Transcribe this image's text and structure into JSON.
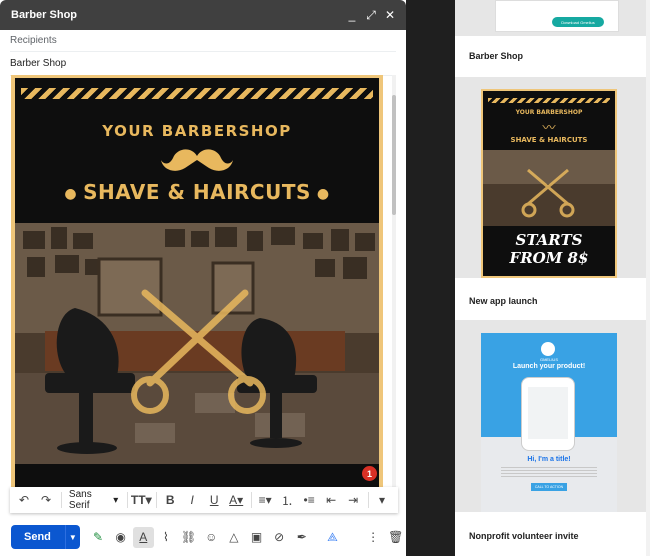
{
  "compose": {
    "title": "Barber Shop",
    "recipients_placeholder": "Recipients",
    "subject": "Barber Shop",
    "controls": {
      "minimize": "_",
      "expand": "⤢",
      "close": "✕"
    }
  },
  "template": {
    "heading": "YOUR BARBERSHOP",
    "subheading": "SHAVE & HAIRCUTS",
    "accent_color": "#e8b85e",
    "background_color": "#0e0e0e",
    "border_color": "#efc67a"
  },
  "badge": {
    "count": "1",
    "color": "#d93025"
  },
  "formatting": {
    "font": "Sans Serif",
    "icons": [
      "undo-icon",
      "redo-icon",
      "text-size-icon",
      "bold-icon",
      "italic-icon",
      "underline-icon",
      "text-color-icon",
      "align-icon",
      "numbered-list-icon",
      "bulleted-list-icon",
      "indent-less-icon",
      "indent-more-icon",
      "more-formatting-icon"
    ]
  },
  "actions": {
    "send_label": "Send",
    "send_color": "#0b57d0"
  },
  "gallery": {
    "cards": [
      {
        "label": "Barber Shop",
        "mini_button": "Download Gmelius"
      },
      {
        "label": "New app launch",
        "promo_line1": "STARTS",
        "promo_line2": "FROM 8$",
        "heading": "YOUR BARBERSHOP",
        "subheading": "SHAVE & HAIRCUTS"
      },
      {
        "label": "Nonprofit volunteer invite",
        "promo_title": "Launch your product!",
        "greeting": "Hi, I'm a title!",
        "cta": "CALL TO ACTION",
        "brand": "GMELIUS"
      }
    ]
  }
}
